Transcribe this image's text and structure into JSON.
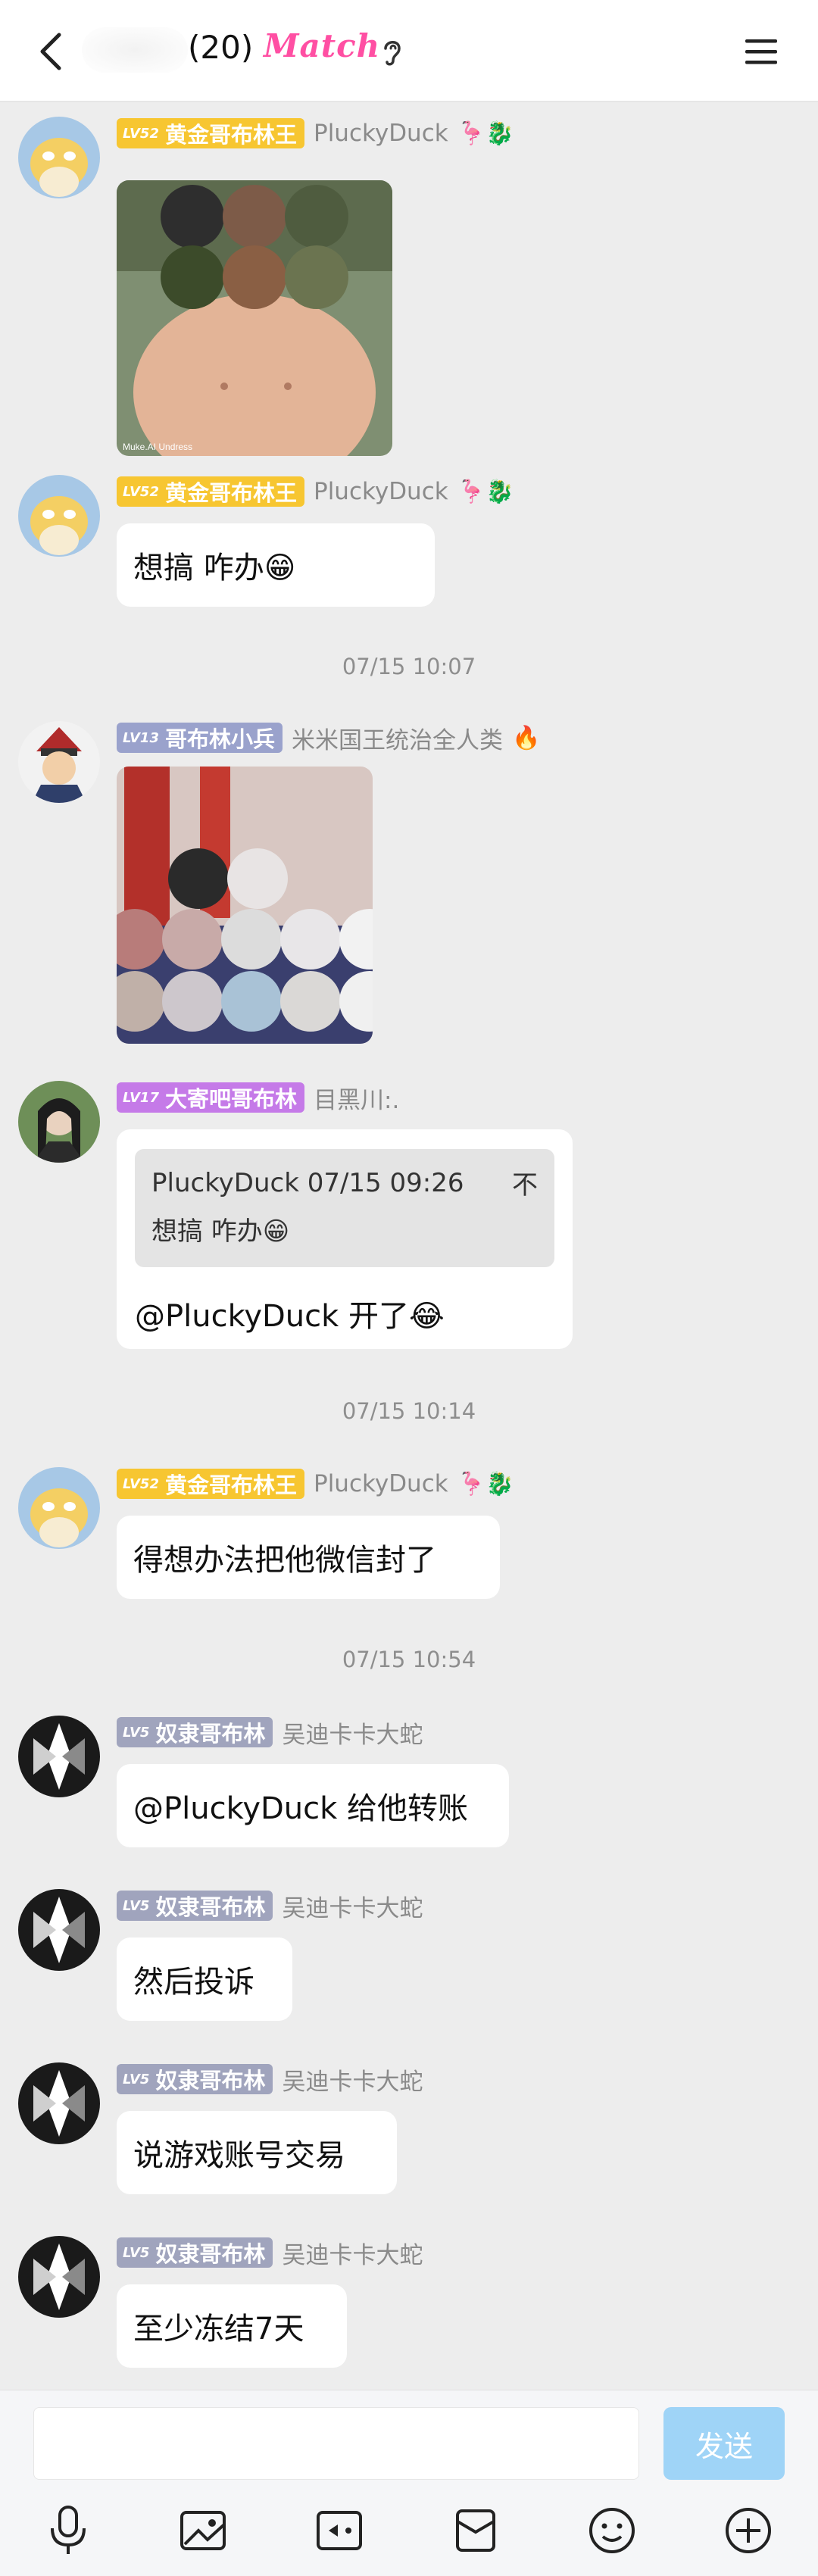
{
  "header": {
    "title_count": "(20)",
    "match_badge": "Match"
  },
  "messages": [
    {
      "level": "LV52",
      "badge": "黄金哥布林王",
      "nickname": "PluckyDuck",
      "emojis": "🦩🐉",
      "type": "image",
      "image_caption": "Muke.AI Undress"
    },
    {
      "level": "LV52",
      "badge": "黄金哥布林王",
      "nickname": "PluckyDuck",
      "emojis": "🦩🐉",
      "type": "text",
      "text": "想搞      咋办😁"
    },
    {
      "type": "time",
      "text": "07/15 10:07"
    },
    {
      "level": "LV13",
      "badge": "哥布林小兵",
      "nickname": "米米国王统治全人类",
      "emojis": "🔥",
      "type": "image"
    },
    {
      "level": "LV17",
      "badge": "大寄吧哥布林",
      "nickname": "目黑川:.",
      "type": "quote",
      "quote_header": "PluckyDuck 07/15 09:26",
      "quote_close": "不",
      "quote_text": "想搞      咋办😁",
      "text": "@PluckyDuck 开了😂"
    },
    {
      "type": "time",
      "text": "07/15 10:14"
    },
    {
      "level": "LV52",
      "badge": "黄金哥布林王",
      "nickname": "PluckyDuck",
      "emojis": "🦩🐉",
      "type": "text",
      "text": "得想办法把他微信封了"
    },
    {
      "type": "time",
      "text": "07/15 10:54"
    },
    {
      "level": "LV5",
      "badge": "奴隶哥布林",
      "nickname": "吴迪卡卡大蛇",
      "type": "text",
      "text": "@PluckyDuck 给他转账"
    },
    {
      "level": "LV5",
      "badge": "奴隶哥布林",
      "nickname": "吴迪卡卡大蛇",
      "type": "text",
      "text": "然后投诉"
    },
    {
      "level": "LV5",
      "badge": "奴隶哥布林",
      "nickname": "吴迪卡卡大蛇",
      "type": "text",
      "text": "说游戏账号交易"
    },
    {
      "level": "LV5",
      "badge": "奴隶哥布林",
      "nickname": "吴迪卡卡大蛇",
      "type": "text",
      "text": "至少冻结7天"
    }
  ],
  "composer": {
    "input_value": "",
    "send_label": "发送"
  },
  "toolbar_icons": [
    "microphone-icon",
    "image-icon",
    "video-icon",
    "gift-box-icon",
    "emoji-icon",
    "plus-icon"
  ],
  "colors": {
    "badge_gold": "#f7c631",
    "badge_purple": "#9aa2cc",
    "badge_violet": "#c57ae8",
    "badge_grey": "#a0a4bd",
    "send_button": "#9fd4f7",
    "match_pink": "#ff4fa3"
  }
}
